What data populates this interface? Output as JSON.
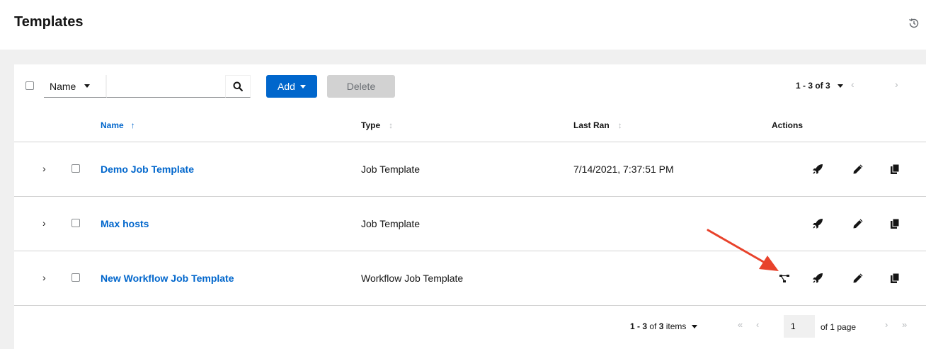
{
  "header": {
    "title": "Templates"
  },
  "toolbar": {
    "filter_label": "Name",
    "search_value": "",
    "add_label": "Add",
    "delete_label": "Delete",
    "pagination_label": "1 - 3 of 3"
  },
  "columns": {
    "name": "Name",
    "type": "Type",
    "last_ran": "Last Ran",
    "actions": "Actions"
  },
  "rows": [
    {
      "name": "Demo Job Template",
      "type": "Job Template",
      "last_ran": "7/14/2021, 7:37:51 PM",
      "actions": [
        "launch-icon",
        "edit-icon",
        "copy-icon"
      ]
    },
    {
      "name": "Max hosts",
      "type": "Job Template",
      "last_ran": "",
      "actions": [
        "launch-icon",
        "edit-icon",
        "copy-icon"
      ]
    },
    {
      "name": "New Workflow Job Template",
      "type": "Workflow Job Template",
      "last_ran": "",
      "actions": [
        "visualizer-icon",
        "launch-icon",
        "edit-icon",
        "copy-icon"
      ]
    }
  ],
  "footer": {
    "range": "1 - 3",
    "of_label": "of",
    "total": "3",
    "items_label": "items",
    "page_value": "1",
    "of_pages_label": "of 1 page"
  },
  "colors": {
    "accent": "#0066cc",
    "annotation_arrow": "#e8422b",
    "disabled_button": "#d2d2d2"
  }
}
